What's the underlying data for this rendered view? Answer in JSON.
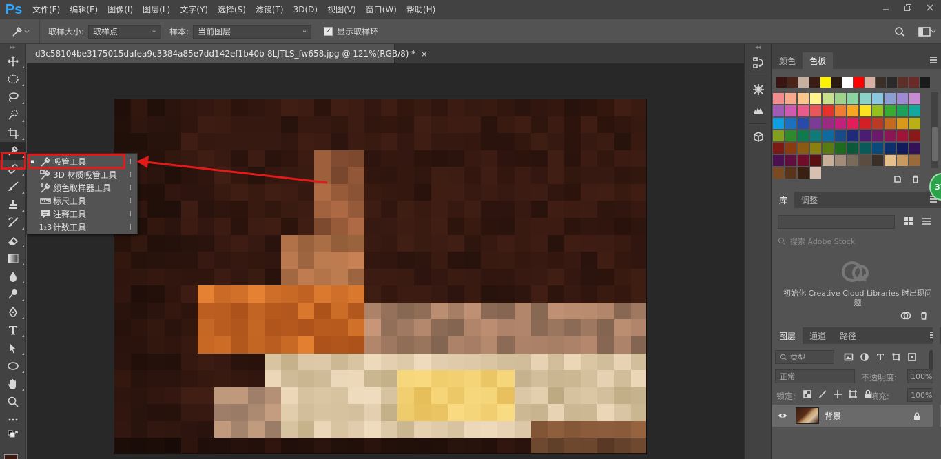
{
  "app": {
    "logo": "Ps",
    "menu": [
      "文件(F)",
      "编辑(E)",
      "图像(I)",
      "图层(L)",
      "文字(Y)",
      "选择(S)",
      "滤镜(T)",
      "3D(D)",
      "视图(V)",
      "窗口(W)",
      "帮助(H)"
    ]
  },
  "options": {
    "sample_size_label": "取样大小:",
    "sample_size_value": "取样点",
    "sample_label": "样本:",
    "sample_value": "当前图层",
    "show_ring_label": "显示取样环",
    "show_ring_checked": "✓"
  },
  "document": {
    "tab_title": "d3c58104be3175015dafea9c3384a85e7dd142ef1b40b-8LJTLS_fw658.jpg @ 121%(RGB/8) *",
    "close": "×"
  },
  "flyout": {
    "items": [
      {
        "label": "吸管工具",
        "key": "I",
        "active": true
      },
      {
        "label": "3D 材质吸管工具",
        "key": "I"
      },
      {
        "label": "颜色取样器工具",
        "key": "I"
      },
      {
        "label": "标尺工具",
        "key": "I"
      },
      {
        "label": "注释工具",
        "key": "I"
      },
      {
        "label": "计数工具",
        "key": "I"
      }
    ],
    "active_bullet": "▪",
    "count_icon_text": "1₂3"
  },
  "panels": {
    "color_tabs": [
      "颜色",
      "色板"
    ],
    "library_tabs": [
      "库",
      "调整"
    ],
    "library_search_placeholder": "搜索 Adobe Stock",
    "library_message": "初始化 Creative Cloud Libraries 时出现问题",
    "layer_tabs": [
      "图层",
      "通道",
      "路径"
    ],
    "layer_filter": "类型",
    "blend_mode": "正常",
    "opacity_label": "不透明度:",
    "opacity_value": "100%",
    "lock_label": "锁定:",
    "fill_label": "填充:",
    "fill_value": "100%",
    "layer_name": "背景"
  },
  "badge": "37",
  "colors": {
    "highlight": "#e11a1a",
    "arrow": "#e11a1a"
  },
  "swatches": {
    "recent": [
      "#3a1410",
      "#4a2418",
      "#c8b0a0",
      "#3a1c14",
      "#fff200",
      "#2a1a10",
      "#ffffff",
      "#ff0000",
      "#d8b0a0",
      "#3a3028",
      "#2a2a2a",
      "#5a3028",
      "#6a2a28",
      "#1a1a1a"
    ],
    "grid": [
      "#f28b8b",
      "#f7a98b",
      "#fbc68b",
      "#fff38b",
      "#c8e08b",
      "#9fd38b",
      "#8bd39f",
      "#8bd3c8",
      "#8bc8e0",
      "#8b9fd3",
      "#9f8bd3",
      "#c88bd3",
      "#a05cb4",
      "#ce5bb0",
      "#e75c8a",
      "#e9575a",
      "#e5322d",
      "#ee7d32",
      "#f6a623",
      "#fbe324",
      "#95c11f",
      "#3aaa35",
      "#1ea05a",
      "#13a89e",
      "#0f9ee0",
      "#1d6fc0",
      "#2a4aa8",
      "#7a3c96",
      "#9a2a82",
      "#c2207a",
      "#e11e5a",
      "#d31f26",
      "#ba3a26",
      "#c46a1e",
      "#d99a1a",
      "#b8b015",
      "#80a01e",
      "#2e8a2a",
      "#0f7a4c",
      "#0f7a78",
      "#0f6aa0",
      "#1a4a8a",
      "#202a7a",
      "#4a1c72",
      "#6a1a6a",
      "#8a1656",
      "#a0143a",
      "#8a1a1a",
      "#7a1a12",
      "#8a3a12",
      "#8a5a12",
      "#8a8010",
      "#5a7a14",
      "#1e6a1e",
      "#0a5a3a",
      "#0a5a5a",
      "#0a4a7a",
      "#0e306a",
      "#121c5a",
      "#341256",
      "#4a1050",
      "#600e3e",
      "#700c2a",
      "#5a1010",
      "#c8b098",
      "#a08c78",
      "#7a6a5a",
      "#5a4c40",
      "#3a3028",
      "#e6c08a",
      "#c89a60",
      "#9a6a38",
      "#7a4a22",
      "#5a3418",
      "#3a2010",
      "#d8c0b0"
    ]
  }
}
